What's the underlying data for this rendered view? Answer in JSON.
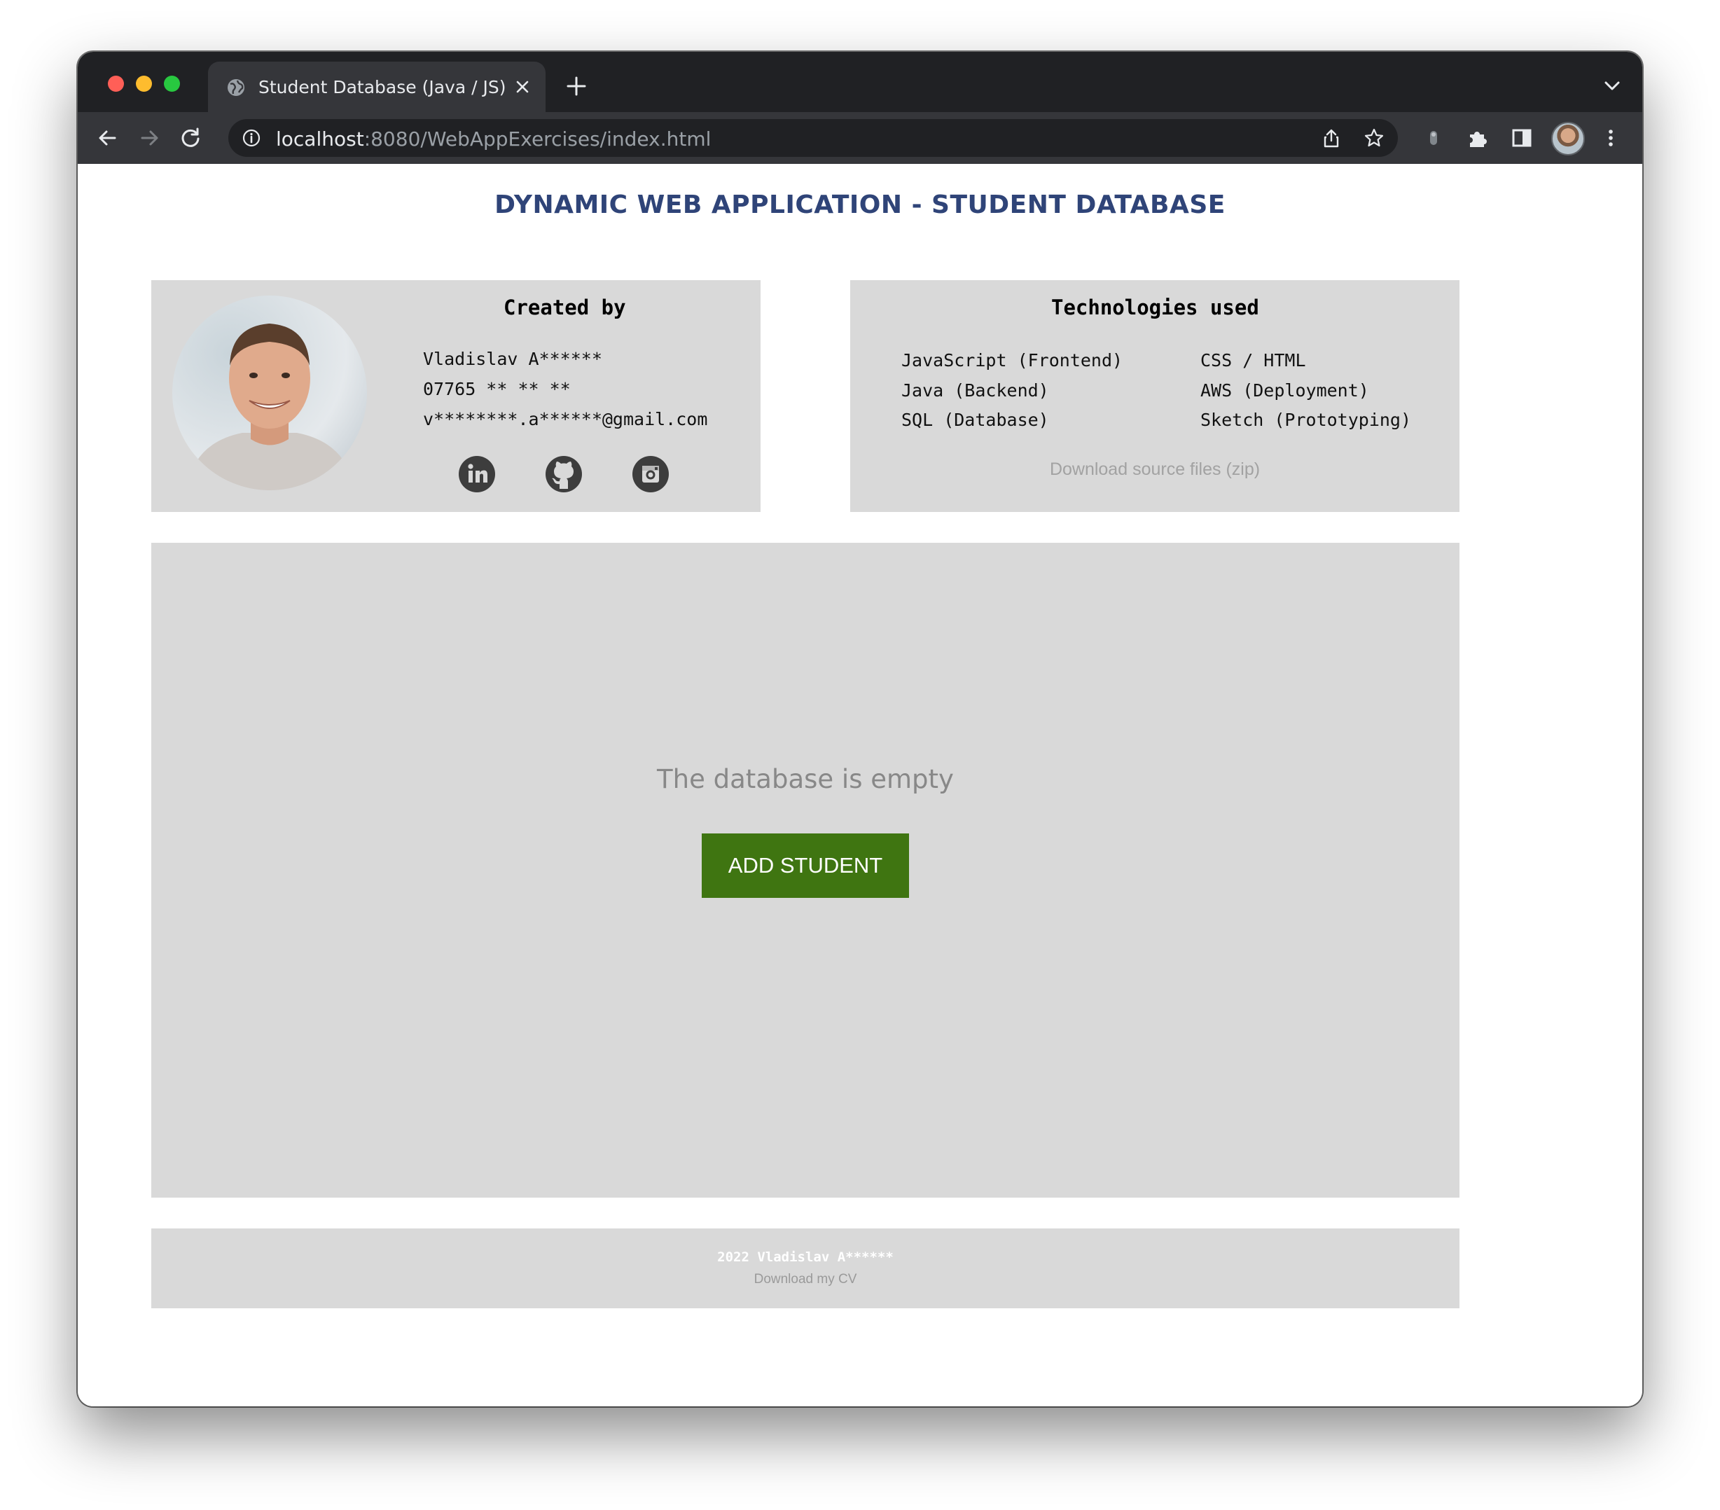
{
  "browser": {
    "tab_title": "Student Database (Java / JS)",
    "url_host": "localhost",
    "url_path": ":8080/WebAppExercises/index.html",
    "icons": [
      "globe-icon",
      "close-icon",
      "plus-icon",
      "chevron-down-icon",
      "back-arrow-icon",
      "forward-arrow-icon",
      "reload-icon",
      "info-icon",
      "share-icon",
      "star-icon",
      "extension-icon",
      "puzzle-icon",
      "sidebar-icon",
      "kebab-menu-icon"
    ]
  },
  "page": {
    "title": "DYNAMIC WEB APPLICATION - STUDENT DATABASE"
  },
  "creator": {
    "heading": "Created by",
    "name": "Vladislav A******",
    "phone": "07765 ** ** **",
    "email": "v********.a******@gmail.com",
    "social_icons": [
      "linkedin-icon",
      "github-icon",
      "instagram-icon"
    ]
  },
  "technologies": {
    "heading": "Technologies used",
    "items": [
      "JavaScript (Frontend)",
      "CSS / HTML",
      "Java (Backend)",
      "AWS (Deployment)",
      "SQL (Database)",
      "Sketch (Prototyping)"
    ],
    "download_link": "Download source files (zip)"
  },
  "database": {
    "empty_message": "The database is empty",
    "add_button": "ADD STUDENT"
  },
  "footer": {
    "line1": "2022 Vladislav A******",
    "cv_link": "Download my CV"
  },
  "colors": {
    "title": "#2f4478",
    "panel": "#d9d9d9",
    "button": "#3f7511",
    "chrome_dark": "#202124",
    "chrome_toolbar": "#35363a"
  }
}
